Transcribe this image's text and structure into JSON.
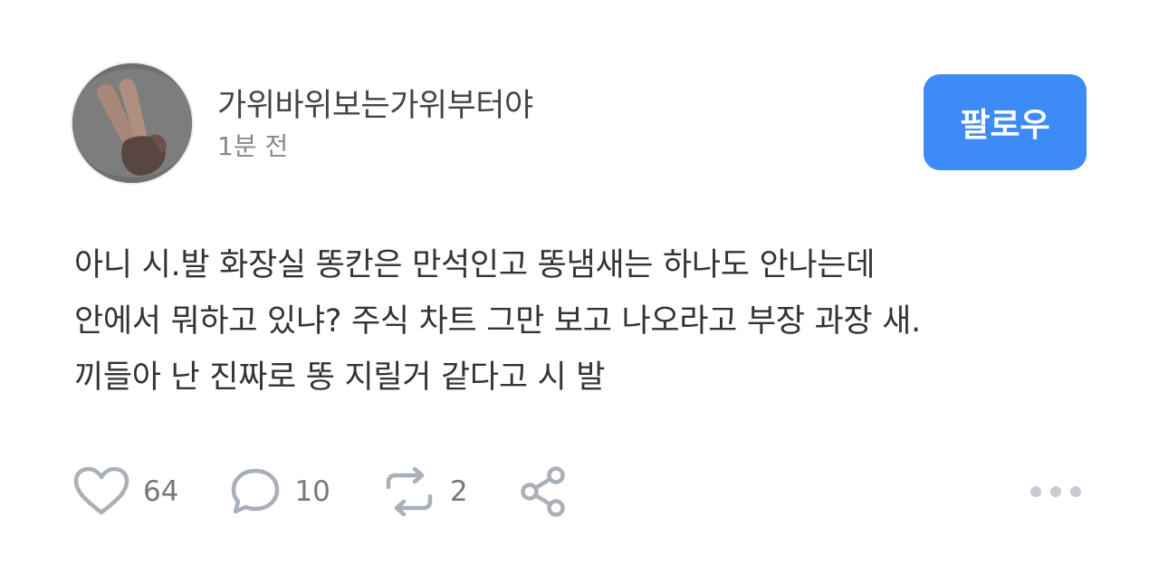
{
  "post": {
    "author": {
      "username": "가위바위보는가위부터야",
      "avatar_icon": "peace-sign-hand-photo"
    },
    "timestamp": "1분 전",
    "follow_label": "팔로우",
    "content_lines": [
      "아니 시.발 화장실 똥칸은 만석인고 똥냄새는 하나도 안나는데",
      "안에서 뭐하고 있냐? 주식 차트 그만 보고 나오라고 부장 과장 새.",
      "끼들아 난 진짜로 똥 지릴거 같다고 시 발"
    ],
    "actions": {
      "like": {
        "icon": "heart-icon",
        "count": "64"
      },
      "comment": {
        "icon": "speech-bubble-icon",
        "count": "10"
      },
      "repost": {
        "icon": "repost-icon",
        "count": "2"
      },
      "share": {
        "icon": "share-icon"
      },
      "more": {
        "icon": "more-dots-icon"
      }
    },
    "colors": {
      "accent": "#3d8bf7",
      "icon_gray": "#a9b0b8",
      "text": "#333333",
      "muted": "#888888"
    }
  }
}
